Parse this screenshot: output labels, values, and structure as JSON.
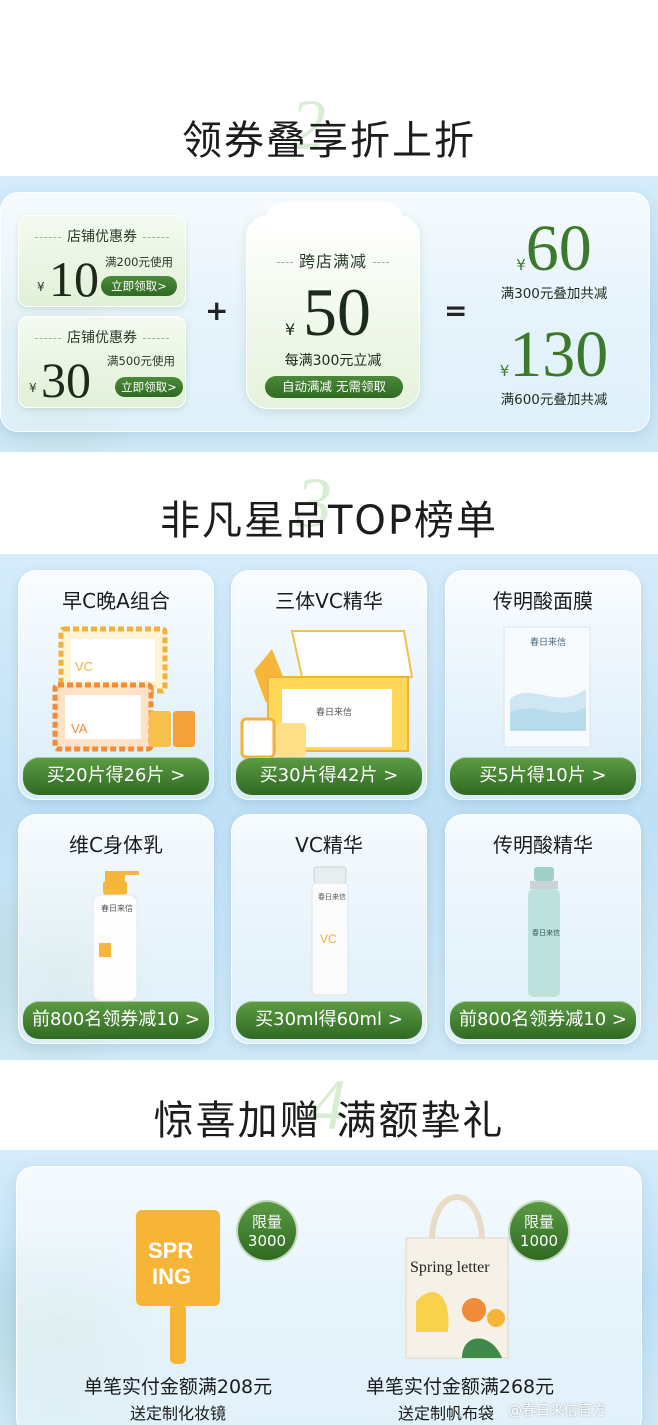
{
  "section1": {
    "number": "2",
    "title": "领券叠享折上折",
    "coupon1": {
      "title": "店铺优惠券",
      "yen": "¥",
      "amount": "10",
      "condition": "满200元使用",
      "button": "立即领取>"
    },
    "coupon2": {
      "title": "店铺优惠券",
      "yen": "¥",
      "amount": "30",
      "condition": "满500元使用",
      "button": "立即领取>"
    },
    "plus": "+",
    "cross": {
      "title": "跨店满减",
      "yen": "¥",
      "amount": "50",
      "condition": "每满300元立减",
      "button": "自动满减 无需领取"
    },
    "equals": "=",
    "result1": {
      "yen": "¥",
      "amount": "60",
      "text": "满300元叠加共减"
    },
    "result2": {
      "yen": "¥",
      "amount": "130",
      "text": "满600元叠加共减"
    }
  },
  "section2": {
    "number": "3",
    "title": "非凡星品TOP榜单",
    "products": [
      {
        "name": "早C晚A组合",
        "offer": "买20片得26片 >"
      },
      {
        "name": "三体VC精华",
        "offer": "买30片得42片 >"
      },
      {
        "name": "传明酸面膜",
        "offer": "买5片得10片 >"
      },
      {
        "name": "维C身体乳",
        "offer": "前800名领券减10 >"
      },
      {
        "name": "VC精华",
        "offer": "买30ml得60ml >"
      },
      {
        "name": "传明酸精华",
        "offer": "前800名领券减10 >"
      }
    ],
    "brand_label": "春日来信",
    "box_labels": {
      "vc": "VC",
      "va": "VA"
    }
  },
  "section3": {
    "number": "4",
    "title": "惊喜加赠 满额挚礼",
    "gift1": {
      "badge_top": "限量",
      "badge_num": "3000",
      "condition": "单笔实付金额满208元",
      "gift": "送定制化妆镜",
      "mirror_text": "SPR\nING"
    },
    "gift2": {
      "badge_top": "限量",
      "badge_num": "1000",
      "condition": "单笔实付金额满268元",
      "gift": "送定制帆布袋",
      "bag_text": "Spring letter"
    },
    "watermark": "@春日来信官方"
  },
  "colors": {
    "accent_green": "#2f6a22",
    "panel_blue": "#cfe8f6"
  }
}
